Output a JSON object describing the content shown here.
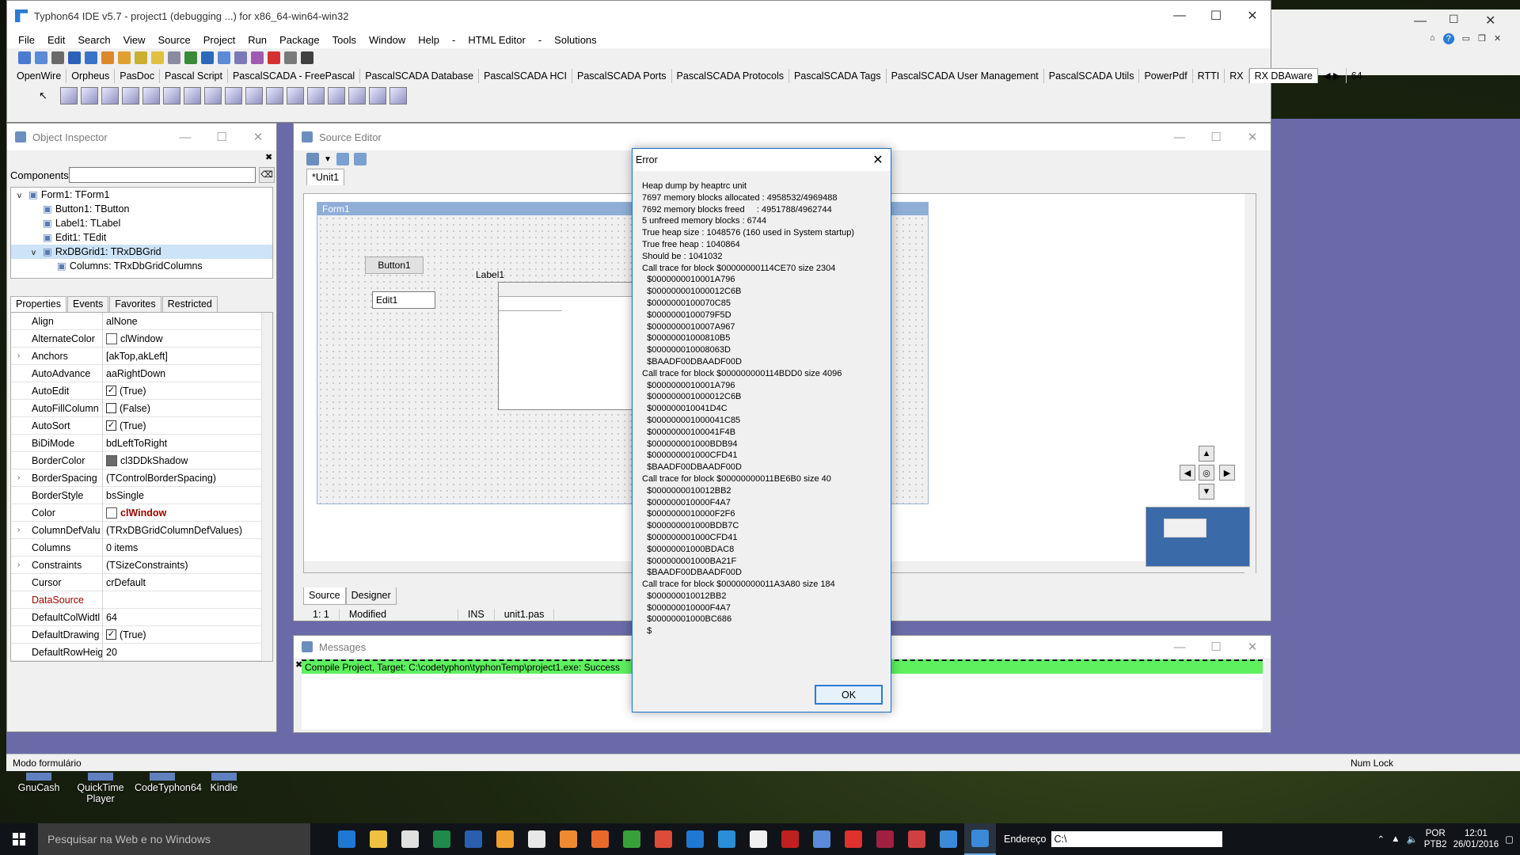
{
  "window": {
    "title": "Typhon64 IDE v5.7 - project1 (debugging ...) for x86_64-win64-win32"
  },
  "menu": [
    "File",
    "Edit",
    "Search",
    "View",
    "Source",
    "Project",
    "Run",
    "Package",
    "Tools",
    "Window",
    "Help",
    "-",
    "HTML Editor",
    "-",
    "Solutions"
  ],
  "palette": {
    "tabs": [
      "OpenWire",
      "Orpheus",
      "PasDoc",
      "Pascal Script",
      "PascalSCADA - FreePascal",
      "PascalSCADA Database",
      "PascalSCADA HCI",
      "PascalSCADA Ports",
      "PascalSCADA Protocols",
      "PascalSCADA Tags",
      "PascalSCADA User Management",
      "PascalSCADA Utils",
      "PowerPdf",
      "RTTI",
      "RX",
      "RX DBAware"
    ],
    "active_tab": "RX DBAware",
    "bitness": "64"
  },
  "object_inspector": {
    "title": "Object Inspector",
    "components_label": "Components",
    "tree": [
      {
        "text": "Form1: TForm1",
        "indent": 0,
        "expander": "v"
      },
      {
        "text": "Button1: TButton",
        "indent": 1,
        "expander": ""
      },
      {
        "text": "Label1: TLabel",
        "indent": 1,
        "expander": ""
      },
      {
        "text": "Edit1: TEdit",
        "indent": 1,
        "expander": ""
      },
      {
        "text": "RxDBGrid1: TRxDBGrid",
        "indent": 1,
        "expander": "v"
      },
      {
        "text": "Columns: TRxDbGridColumns",
        "indent": 2,
        "expander": ""
      }
    ],
    "tabs": [
      "Properties",
      "Events",
      "Favorites",
      "Restricted"
    ],
    "properties": [
      {
        "name": "Align",
        "value": "alNone",
        "exp": "",
        "chk": "",
        "swatch": ""
      },
      {
        "name": "AlternateColor",
        "value": "clWindow",
        "exp": "",
        "chk": "",
        "swatch": "#ffffff"
      },
      {
        "name": "Anchors",
        "value": "[akTop,akLeft]",
        "exp": ">",
        "chk": "",
        "swatch": ""
      },
      {
        "name": "AutoAdvance",
        "value": "aaRightDown",
        "exp": "",
        "chk": "",
        "swatch": ""
      },
      {
        "name": "AutoEdit",
        "value": "(True)",
        "exp": "",
        "chk": "✓",
        "swatch": ""
      },
      {
        "name": "AutoFillColumn",
        "value": "(False)",
        "exp": "",
        "chk": " ",
        "swatch": ""
      },
      {
        "name": "AutoSort",
        "value": "(True)",
        "exp": "",
        "chk": "✓",
        "swatch": ""
      },
      {
        "name": "BiDiMode",
        "value": "bdLeftToRight",
        "exp": "",
        "chk": "",
        "swatch": ""
      },
      {
        "name": "BorderColor",
        "value": "cl3DDkShadow",
        "exp": "",
        "chk": "",
        "swatch": "#696969"
      },
      {
        "name": "BorderSpacing",
        "value": "(TControlBorderSpacing)",
        "exp": ">",
        "chk": "",
        "swatch": ""
      },
      {
        "name": "BorderStyle",
        "value": "bsSingle",
        "exp": "",
        "chk": "",
        "swatch": ""
      },
      {
        "name": "Color",
        "value": "clWindow",
        "exp": "",
        "chk": "",
        "swatch": "#ffffff",
        "value_style": "red bold"
      },
      {
        "name": "ColumnDefValu",
        "value": "(TRxDBGridColumnDefValues)",
        "exp": ">",
        "chk": "",
        "swatch": ""
      },
      {
        "name": "Columns",
        "value": "0 items",
        "exp": "",
        "chk": "",
        "swatch": ""
      },
      {
        "name": "Constraints",
        "value": "(TSizeConstraints)",
        "exp": ">",
        "chk": "",
        "swatch": ""
      },
      {
        "name": "Cursor",
        "value": "crDefault",
        "exp": "",
        "chk": "",
        "swatch": ""
      },
      {
        "name": "DataSource",
        "value": "",
        "exp": "",
        "chk": "",
        "swatch": "",
        "name_style": "red"
      },
      {
        "name": "DefaultColWidtl",
        "value": "64",
        "exp": "",
        "chk": "",
        "swatch": ""
      },
      {
        "name": "DefaultDrawing",
        "value": "(True)",
        "exp": "",
        "chk": "✓",
        "swatch": ""
      },
      {
        "name": "DefaultRowHeig",
        "value": "20",
        "exp": "",
        "chk": "",
        "swatch": ""
      }
    ]
  },
  "source_editor": {
    "title": "Source Editor",
    "tab": "*Unit1",
    "form_title": "Form1",
    "button1": "Button1",
    "label1": "Label1",
    "edit1": "Edit1",
    "bottom_tabs": [
      "Source",
      "Designer"
    ],
    "status": {
      "pos": "1:   1",
      "modified": "Modified",
      "mode": "INS",
      "file": "unit1.pas"
    }
  },
  "messages": {
    "title": "Messages",
    "line": "Compile Project, Target: C:\\codetyphon\\typhonTemp\\project1.exe: Success"
  },
  "error_dialog": {
    "title": "Error",
    "body": "Heap dump by heaptrc unit\n7697 memory blocks allocated : 4958532/4969488\n7692 memory blocks freed     : 4951788/4962744\n5 unfreed memory blocks : 6744\nTrue heap size : 1048576 (160 used in System startup)\nTrue free heap : 1040864\nShould be : 1041032\nCall trace for block $00000000114CE70 size 2304\n  $0000000010001A796\n  $000000001000012C6B\n  $0000000100070C85\n  $0000000100079F5D\n  $0000000010007A967\n  $00000001000810B5\n  $000000010008063D\n  $BAADF00DBAADF00D\nCall trace for block $000000000114BDD0 size 4096\n  $0000000010001A796\n  $000000001000012C6B\n  $000000010041D4C\n  $000000001000041C85\n  $00000000100041F4B\n  $000000001000BDB94\n  $000000001000CFD41\n  $BAADF00DBAADF00D\nCall trace for block $00000000011BE6B0 size 40\n  $0000000010012BB2\n  $000000010000F4A7\n  $0000000010000F2F6\n  $000000001000BDB7C\n  $000000001000CFD41\n  $00000001000BDAC8\n  $000000001000BA21F\n  $BAADF00DBAADF00D\nCall trace for block $00000000011A3A80 size 184\n  $000000010012BB2\n  $000000010000F4A7\n  $00000001000BC686\n  $",
    "ok": "OK"
  },
  "app_status": "Modo formulário",
  "num_lock": "Num Lock",
  "desktop_icons": [
    "GnuCash",
    "QuickTime Player",
    "CodeTyphon64",
    "Kindle"
  ],
  "taskbar": {
    "search_placeholder": "Pesquisar na Web e no Windows",
    "address_label": "Endereço",
    "address_value": "C:\\",
    "lang1": "POR",
    "lang2": "PTB2",
    "time": "12:01",
    "date": "26/01/2016"
  }
}
